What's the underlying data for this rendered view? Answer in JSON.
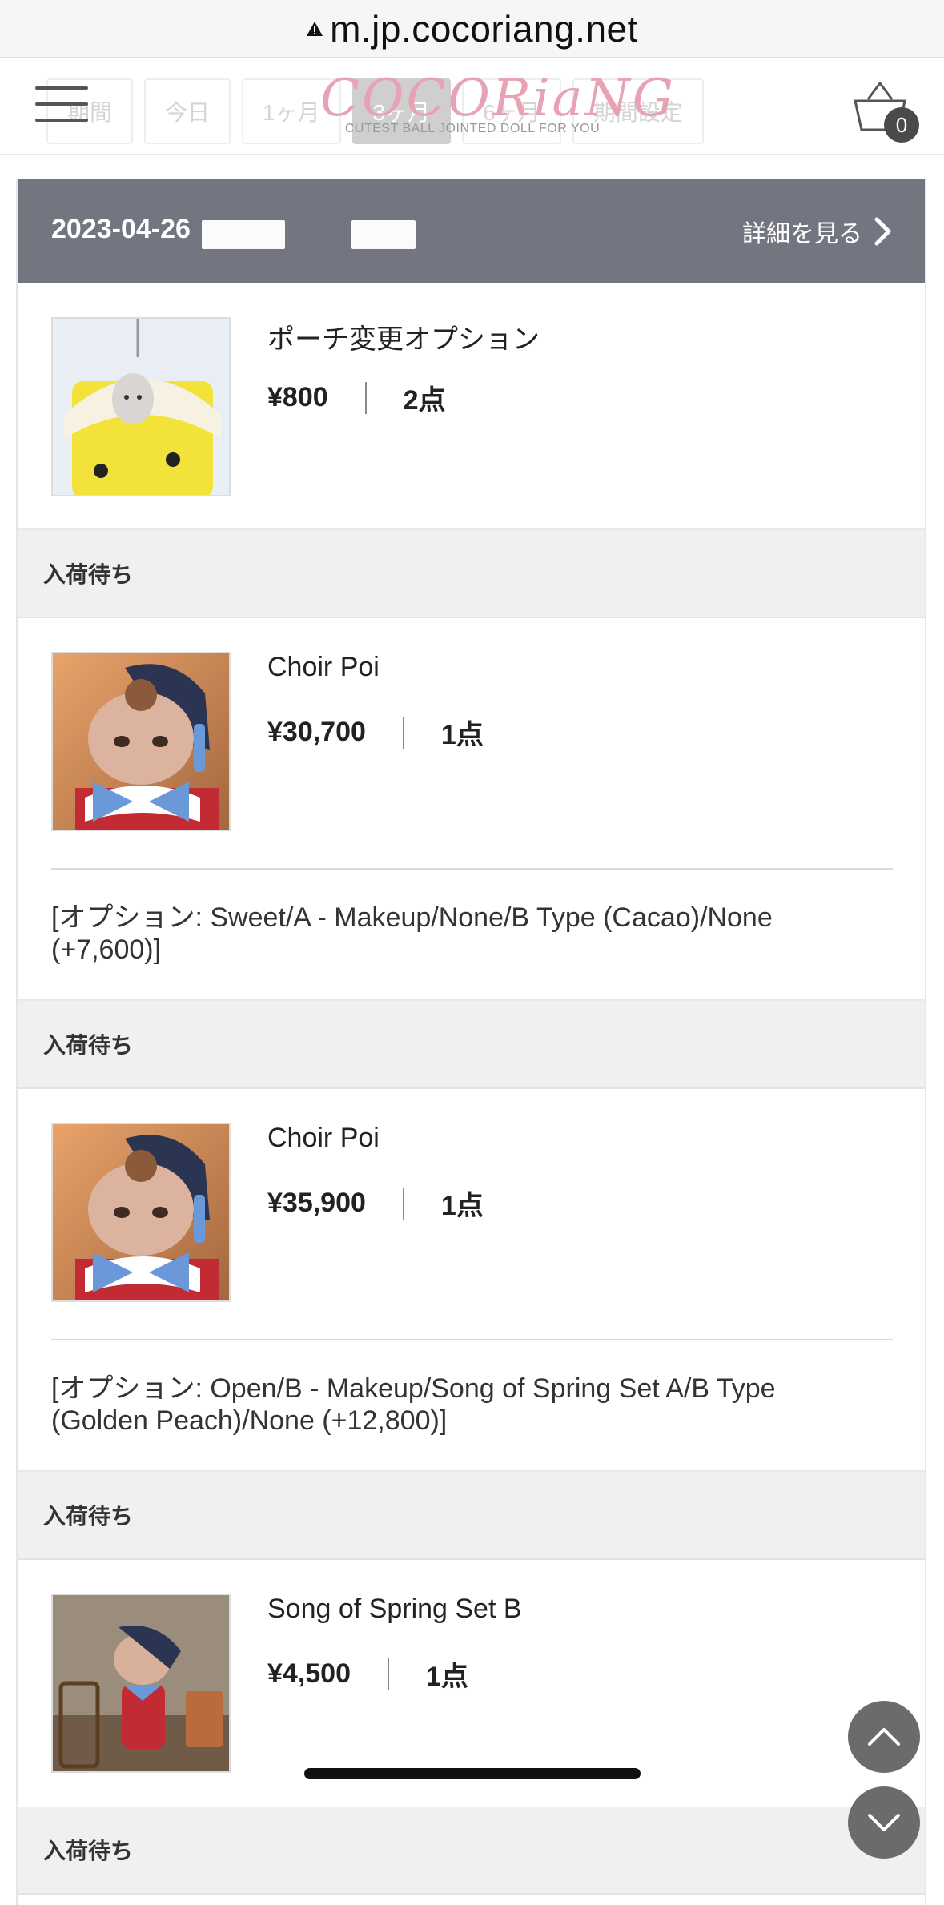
{
  "browser": {
    "url": "m.jp.cocoriang.net"
  },
  "header": {
    "menu_icon": "hamburger-icon",
    "ghost_tabs": [
      "期間",
      "今日",
      "1ヶ月",
      "3ヶ月",
      "6ヶ月",
      "期間設定"
    ],
    "logo_text": "COCORiaNG",
    "logo_tagline": "CUTEST BALL JOINTED DOLL FOR YOU",
    "cart_count": "0"
  },
  "order": {
    "date": "2023-04-26",
    "detail_label": "詳細を見る",
    "items": [
      {
        "name": "ポーチ変更オプション",
        "price": "¥800",
        "qty": "2点",
        "option": "",
        "status": "入荷待ち"
      },
      {
        "name": "Choir Poi",
        "price": "¥30,700",
        "qty": "1点",
        "option": "[オプション: Sweet/A - Makeup/None/B Type (Cacao)/None (+7,600)]",
        "status": "入荷待ち"
      },
      {
        "name": "Choir Poi",
        "price": "¥35,900",
        "qty": "1点",
        "option": "[オプション: Open/B - Makeup/Song of Spring Set A/B Type (Golden Peach)/None (+12,800)]",
        "status": "入荷待ち"
      },
      {
        "name": "Song of Spring Set B",
        "price": "¥4,500",
        "qty": "1点",
        "option": "",
        "status": "入荷待ち"
      }
    ]
  },
  "colors": {
    "header_bar": "#737680",
    "status_bg": "#f0f0f0",
    "logo_pink": "#e7a2b4",
    "fab": "#6b6b6b"
  }
}
